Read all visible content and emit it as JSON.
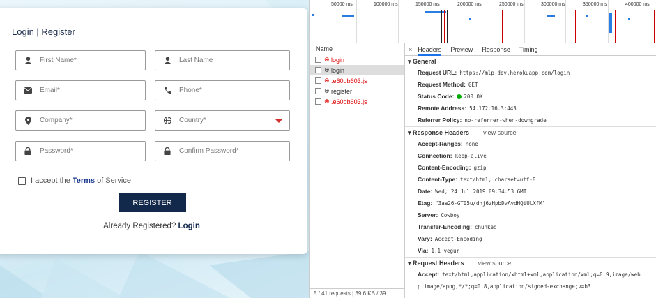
{
  "form": {
    "title": "Login | Register",
    "fields": {
      "first_name": "First Name*",
      "last_name": "Last Name",
      "email": "Email*",
      "phone": "Phone*",
      "company": "Company*",
      "country": "Country*",
      "password": "Password*",
      "confirm_password": "Confirm Password*"
    },
    "terms_prefix": "I accept the",
    "terms_link": "Terms",
    "terms_suffix": "of Service",
    "register_label": "REGISTER",
    "already_text": "Already Registered?",
    "login_link": "Login"
  },
  "devtools": {
    "timeline_ticks": [
      "50000 ms",
      "100000 ms",
      "150000 ms",
      "200000 ms",
      "250000 ms",
      "300000 ms",
      "350000 ms",
      "400000 ms"
    ],
    "name_header": "Name",
    "requests": [
      {
        "name": "login",
        "error": true
      },
      {
        "name": "login",
        "error": false
      },
      {
        "name": ".e60db603.js",
        "error": true
      },
      {
        "name": "register",
        "error": false
      },
      {
        "name": ".e60db603.js",
        "error": true
      }
    ],
    "status_bar": "5 / 41 requests | 39.6 KB / 39",
    "tabs": {
      "close": "×",
      "headers": "Headers",
      "preview": "Preview",
      "response": "Response",
      "timing": "Timing"
    },
    "general": {
      "title": "▾ General",
      "request_url_k": "Request URL:",
      "request_url_v": "https://mlp-dev.herokuapp.com/login",
      "method_k": "Request Method:",
      "method_v": "GET",
      "status_k": "Status Code:",
      "status_v": "200 OK",
      "remote_k": "Remote Address:",
      "remote_v": "54.172.16.3:443",
      "referrer_k": "Referrer Policy:",
      "referrer_v": "no-referrer-when-downgrade"
    },
    "response_headers": {
      "title": "▾ Response Headers",
      "view_source": "view source",
      "items": [
        {
          "k": "Accept-Ranges:",
          "v": "none"
        },
        {
          "k": "Connection:",
          "v": "keep-alive"
        },
        {
          "k": "Content-Encoding:",
          "v": "gzip"
        },
        {
          "k": "Content-Type:",
          "v": "text/html; charset=utf-8"
        },
        {
          "k": "Date:",
          "v": "Wed, 24 Jul 2019 09:34:53 GMT"
        },
        {
          "k": "Etag:",
          "v": "\"3aa26-GT05u/dhj6zHpbDvAvdHQiULXfM\""
        },
        {
          "k": "Server:",
          "v": "Cowboy"
        },
        {
          "k": "Transfer-Encoding:",
          "v": "chunked"
        },
        {
          "k": "Vary:",
          "v": "Accept-Encoding"
        },
        {
          "k": "Via:",
          "v": "1.1 vegur"
        }
      ]
    },
    "request_headers": {
      "title": "▾ Request Headers",
      "view_source": "view source",
      "accept_k": "Accept:",
      "accept_v": "text/html,application/xhtml+xml,application/xml;q=0.9,image/web",
      "accept_v2": "p,image/apng,*/*;q=0.8,application/signed-exchange;v=b3"
    },
    "colors": {
      "accent": "#1a73e8",
      "error": "#dd0000",
      "status_ok": "#00aa00"
    }
  }
}
